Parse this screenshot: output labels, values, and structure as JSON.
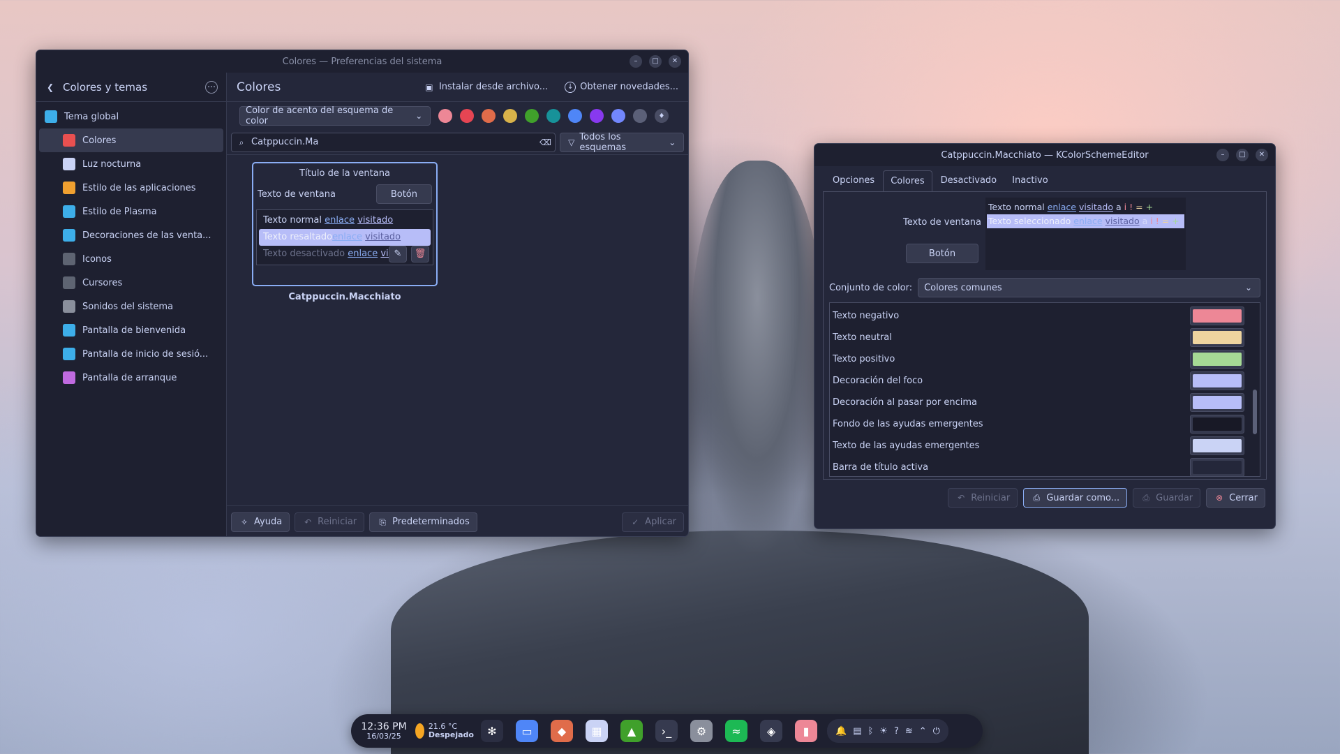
{
  "sysWindow": {
    "title": "Colores — Preferencias del sistema",
    "sidebar": {
      "back_label": "Colores y temas",
      "items": [
        {
          "label": "Tema global",
          "icon": "global-theme-icon",
          "color": "#3daee9"
        },
        {
          "label": "Colores",
          "icon": "colors-icon",
          "color": "#e95050"
        },
        {
          "label": "Luz nocturna",
          "icon": "night-light-icon",
          "color": "#cad3f5"
        },
        {
          "label": "Estilo de las aplicaciones",
          "icon": "app-style-icon",
          "color": "#f0a030"
        },
        {
          "label": "Estilo de Plasma",
          "icon": "plasma-style-icon",
          "color": "#3daee9"
        },
        {
          "label": "Decoraciones de las venta...",
          "icon": "window-decorations-icon",
          "color": "#3daee9"
        },
        {
          "label": "Iconos",
          "icon": "icons-icon",
          "color": "#5e6472"
        },
        {
          "label": "Cursores",
          "icon": "cursors-icon",
          "color": "#5e6472"
        },
        {
          "label": "Sonidos del sistema",
          "icon": "system-sounds-icon",
          "color": "#8a8f9c"
        },
        {
          "label": "Pantalla de bienvenida",
          "icon": "splash-screen-icon",
          "color": "#3daee9"
        },
        {
          "label": "Pantalla de inicio de sesió...",
          "icon": "login-screen-icon",
          "color": "#3daee9"
        },
        {
          "label": "Pantalla de arranque",
          "icon": "boot-screen-icon",
          "color": "#c06ae0"
        }
      ]
    },
    "header": {
      "title": "Colores",
      "install_label": "Instalar desde archivo...",
      "get_new_label": "Obtener novedades..."
    },
    "accent": {
      "select_label": "Color de acento del esquema de color",
      "swatches": [
        "#ed8796",
        "#e64553",
        "#e06c4a",
        "#d8b24a",
        "#40a02b",
        "#179299",
        "#4f86f7",
        "#8839ef",
        "#7287fd",
        "#5b6078"
      ]
    },
    "search": {
      "value": "Catppuccin.Ma",
      "filter_label": "Todos los esquemas"
    },
    "preview": {
      "window_title": "Título de la ventana",
      "window_text": "Texto de ventana",
      "button_label": "Botón",
      "normal_text": "Texto normal",
      "highlight_text": "Texto resaltado",
      "disabled_text": "Texto desactivado",
      "link": "enlace",
      "visited": "visitado",
      "visited_trunc": "visi",
      "scheme_name": "Catppuccin.Macchiato"
    },
    "footer": {
      "help": "Ayuda",
      "reset": "Reiniciar",
      "defaults": "Predeterminados",
      "apply": "Aplicar"
    }
  },
  "editorWindow": {
    "title": "Catppuccin.Macchiato — KColorSchemeEditor",
    "tabs": [
      "Opciones",
      "Colores",
      "Desactivado",
      "Inactivo"
    ],
    "preview": {
      "window_text": "Texto de ventana",
      "button_label": "Botón",
      "normal_text": "Texto normal",
      "selected_text": "Texto seleccionado",
      "link": "enlace",
      "visited": "visitado",
      "symbols": [
        "a",
        "i",
        "!",
        "=",
        "+"
      ]
    },
    "colorset_label": "Conjunto de color:",
    "colorset_value": "Colores comunes",
    "rows": [
      {
        "label": "Texto negativo",
        "color": "#ed8796"
      },
      {
        "label": "Texto neutral",
        "color": "#eed49f"
      },
      {
        "label": "Texto positivo",
        "color": "#a6da95"
      },
      {
        "label": "Decoración del foco",
        "color": "#b7bdf8"
      },
      {
        "label": "Decoración al pasar por encima",
        "color": "#b7bdf8"
      },
      {
        "label": "Fondo de las ayudas emergentes",
        "color": "#181926"
      },
      {
        "label": "Texto de las ayudas emergentes",
        "color": "#cad3f5"
      },
      {
        "label": "Barra de título activa",
        "color": "#24273a"
      }
    ],
    "footer": {
      "reset": "Reiniciar",
      "save_as": "Guardar como...",
      "save": "Guardar",
      "close": "Cerrar"
    }
  },
  "taskbar": {
    "time": "12:36 PM",
    "date": "16/03/25",
    "temperature": "21.6 °C",
    "condition": "Despejado",
    "apps": [
      {
        "name": "kde-icon",
        "color": "#2b2e42"
      },
      {
        "name": "files-icon",
        "color": "#4f86f7"
      },
      {
        "name": "firefox-icon",
        "color": "#e06c4a"
      },
      {
        "name": "store-icon",
        "color": "#cad3f5"
      },
      {
        "name": "image-viewer-icon",
        "color": "#40a02b"
      },
      {
        "name": "terminal-icon",
        "color": "#363a4f"
      },
      {
        "name": "settings-icon",
        "color": "#8a8f9c"
      },
      {
        "name": "spotify-icon",
        "color": "#1db954"
      },
      {
        "name": "android-icon",
        "color": "#363a4f"
      },
      {
        "name": "audio-app-icon",
        "color": "#ed8796"
      }
    ]
  }
}
